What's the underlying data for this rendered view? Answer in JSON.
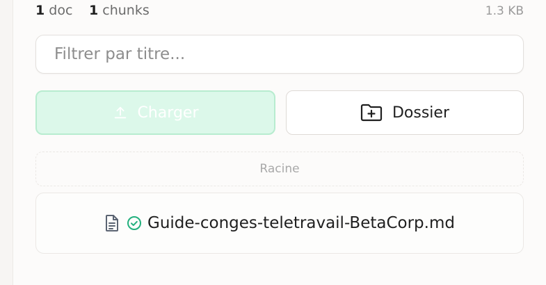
{
  "stats": {
    "docs_count": "1",
    "docs_label": "doc",
    "chunks_count": "1",
    "chunks_label": "chunks",
    "size": "1.3 KB"
  },
  "filter": {
    "placeholder": "Filtrer par titre..."
  },
  "actions": {
    "upload_label": "Charger",
    "folder_label": "Dossier",
    "upload_icon": "upload-icon",
    "folder_icon": "folder-plus-icon"
  },
  "tree": {
    "root_label": "Racine",
    "files": [
      {
        "name": "Guide-conges-teletravail-BetaCorp.md",
        "type_icon": "document-icon",
        "status_icon": "check-circle-icon",
        "status_color": "#22b07d"
      }
    ]
  },
  "colors": {
    "upload_bg": "#dcf8ea",
    "upload_border": "#b7eccf",
    "success": "#22b07d"
  }
}
